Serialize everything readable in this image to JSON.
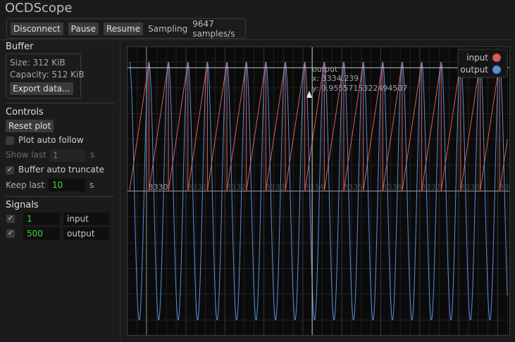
{
  "app": {
    "title": "OCDScope"
  },
  "toolbar": {
    "disconnect_label": "Disconnect",
    "pause_label": "Pause",
    "resume_label": "Resume",
    "status_label": "Sampling",
    "rate_text": "9647 samples/s"
  },
  "buffer": {
    "header": "Buffer",
    "size_text": "Size: 312 KiB",
    "capacity_text": "Capacity: 512 KiB",
    "export_label": "Export data..."
  },
  "controls": {
    "header": "Controls",
    "reset_label": "Reset plot",
    "auto_follow_label": "Plot auto follow",
    "auto_follow_checked": false,
    "show_last_label": "Show last",
    "show_last_value": "1",
    "show_last_unit": "s",
    "auto_truncate_label": "Buffer auto truncate",
    "auto_truncate_checked": true,
    "keep_last_label": "Keep last",
    "keep_last_value": "10",
    "keep_last_unit": "s"
  },
  "signals": {
    "header": "Signals",
    "items": [
      {
        "checked": true,
        "id": "1",
        "name": "input"
      },
      {
        "checked": true,
        "id": "500",
        "name": "output"
      }
    ]
  },
  "colors": {
    "input": "#d9605a",
    "output": "#5b8fd6"
  },
  "plot": {
    "cursor_series": "output",
    "cursor_x_text": "x: 3334.239",
    "cursor_y_text": "y: 0.9555715322494507",
    "x_ticks": [
      "3330",
      "3331",
      "3332",
      "3333",
      "3334",
      "3335",
      "3336",
      "3337",
      "3338",
      "3339"
    ],
    "legend": [
      {
        "name": "input",
        "icon": "red-dot-icon"
      },
      {
        "name": "output",
        "icon": "blue-dot-icon"
      }
    ]
  },
  "chart_data": {
    "type": "line",
    "xlim": [
      3329.5,
      3339.3
    ],
    "ylim": [
      -1.05,
      1.05
    ],
    "x_ticks": [
      3330,
      3331,
      3332,
      3333,
      3334,
      3335,
      3336,
      3337,
      3338,
      3339
    ],
    "legend_placement": "top-right",
    "grid": true,
    "series": [
      {
        "name": "input",
        "kind": "sawtooth",
        "period": 0.5,
        "min": 0.0,
        "max": 1.0
      },
      {
        "name": "output",
        "kind": "sine",
        "period": 0.5,
        "amplitude": 1.0
      }
    ]
  }
}
